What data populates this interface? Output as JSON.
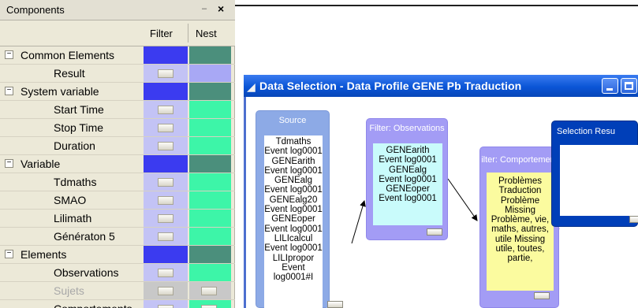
{
  "components": {
    "title": "Components",
    "pin_icon": "pin-icon",
    "close_icon": "close-icon",
    "headers": {
      "filter": "Filter",
      "nest": "Nest"
    },
    "colors": {
      "category_filter": "#3b3bf0",
      "category_nest": "#4b8f7c",
      "item_filter": "#c3c3f5",
      "item_nest": "#3df5a8",
      "disabled": "#c8c8c8",
      "result_nest": "#a8a8f5"
    },
    "rows": [
      {
        "kind": "category",
        "label": "Common Elements",
        "expanded": true
      },
      {
        "kind": "item",
        "label": "Result",
        "filter": true,
        "nest": false
      },
      {
        "kind": "category",
        "label": "System variable",
        "expanded": true
      },
      {
        "kind": "item",
        "label": "Start Time",
        "filter": true,
        "nest": false
      },
      {
        "kind": "item",
        "label": "Stop Time",
        "filter": true,
        "nest": false
      },
      {
        "kind": "item",
        "label": "Duration",
        "filter": true,
        "nest": false
      },
      {
        "kind": "category",
        "label": "Variable",
        "expanded": true
      },
      {
        "kind": "item",
        "label": "Tdmaths",
        "filter": true,
        "nest": false
      },
      {
        "kind": "item",
        "label": "SMAO",
        "filter": true,
        "nest": false
      },
      {
        "kind": "item",
        "label": "Lilimath",
        "filter": true,
        "nest": false
      },
      {
        "kind": "item",
        "label": "Génératon 5",
        "filter": true,
        "nest": false
      },
      {
        "kind": "category",
        "label": "Elements",
        "expanded": true
      },
      {
        "kind": "item",
        "label": "Observations",
        "filter": true,
        "nest": false
      },
      {
        "kind": "item",
        "label": "Sujets",
        "filter": true,
        "nest": true,
        "disabled": true
      },
      {
        "kind": "item",
        "label": "Comportements",
        "filter": true,
        "nest": true
      }
    ]
  },
  "data_selection": {
    "title": "Data Selection - Data Profile  GENE Pb Traduction",
    "app_icon": "data-selection-app-icon",
    "minimize_icon": "minimize-icon",
    "maximize_icon": "maximize-icon",
    "nodes": {
      "source": {
        "title": "Source",
        "lines": [
          "Tdmaths",
          "Event log0001",
          "GENEarith",
          "Event log0001",
          "GENEalg",
          "Event log0001",
          "GENEalg20",
          "Event log0001",
          "GENEoper",
          "Event log0001",
          "LILIcalcul",
          "Event log0001",
          "LILIpropor",
          "Event log0001#I"
        ]
      },
      "observations": {
        "title": "Filter: Observations",
        "lines": [
          "GENEarith",
          "Event log0001",
          "GENEalg",
          "Event log0001",
          "GENEoper",
          "Event log0001"
        ]
      },
      "comportements": {
        "title": "ilter: Comportement",
        "lines": [
          "Problèmes",
          "Traduction",
          "Problème",
          "Missing",
          "Problème, vie,",
          "maths, autres,",
          "utile Missing",
          "utile, toutes,",
          "partie,"
        ]
      },
      "result": {
        "title": "Selection Resu",
        "lines": []
      }
    }
  }
}
